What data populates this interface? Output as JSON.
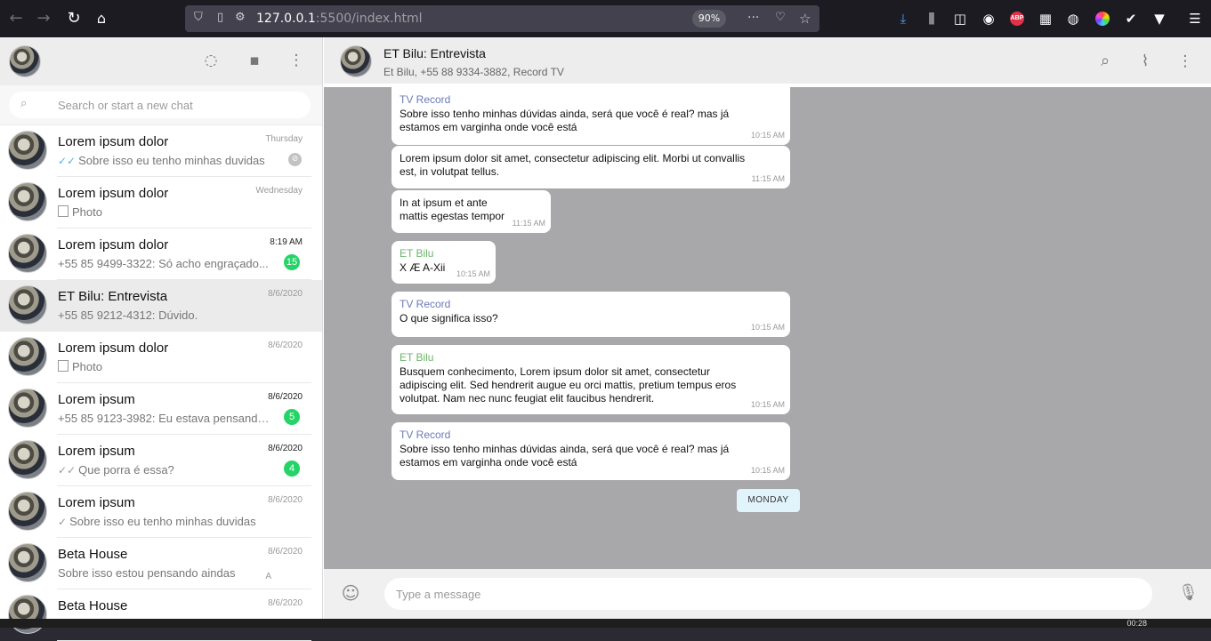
{
  "browser": {
    "url_host": "127.0.0.1",
    "url_rest": ":5500/index.html",
    "zoom": "90%",
    "abp_label": "ABP"
  },
  "sidebar": {
    "search_placeholder": "Search or start a new chat",
    "chats": [
      {
        "name": "Lorem ipsum dolor",
        "time": "Thursday",
        "time_bold": false,
        "tick": "blue",
        "preview": "Sobre isso eu tenho minhas duvidas",
        "muted": true,
        "badge": null,
        "photo": false,
        "active": false
      },
      {
        "name": "Lorem ipsum dolor",
        "time": "Wednesday",
        "time_bold": false,
        "tick": null,
        "preview": "Photo",
        "muted": false,
        "badge": null,
        "photo": true,
        "active": false
      },
      {
        "name": "Lorem ipsum dolor",
        "time": "8:19 AM",
        "time_bold": true,
        "tick": null,
        "preview": "+55 85 9499-3322: Só acho engraçado...",
        "muted": false,
        "badge": "15",
        "photo": false,
        "active": false
      },
      {
        "name": "ET Bilu: Entrevista",
        "time": "8/6/2020",
        "time_bold": false,
        "tick": null,
        "preview": "+55 85 9212-4312: Dúvido.",
        "muted": false,
        "badge": null,
        "photo": false,
        "active": true
      },
      {
        "name": "Lorem ipsum dolor",
        "time": "8/6/2020",
        "time_bold": false,
        "tick": null,
        "preview": "Photo",
        "muted": false,
        "badge": null,
        "photo": true,
        "active": false
      },
      {
        "name": "Lorem ipsum",
        "time": "8/6/2020",
        "time_bold": true,
        "tick": null,
        "preview": "+55 85 9123-3982: Eu estava pensando...",
        "muted": false,
        "badge": "5",
        "photo": false,
        "active": false
      },
      {
        "name": "Lorem ipsum",
        "time": "8/6/2020",
        "time_bold": true,
        "tick": "grey",
        "preview": "Que porra é essa?",
        "muted": false,
        "badge": "4",
        "photo": false,
        "active": false
      },
      {
        "name": "Lorem ipsum",
        "time": "8/6/2020",
        "time_bold": false,
        "tick": "grey-single",
        "preview": "Sobre isso eu tenho minhas duvidas",
        "muted": false,
        "badge": null,
        "photo": false,
        "active": false
      },
      {
        "name": "Beta House",
        "time": "8/6/2020",
        "time_bold": false,
        "tick": null,
        "preview": "Sobre isso estou pensando aindas",
        "muted": false,
        "badge": null,
        "photo": false,
        "active": false,
        "mark": "A"
      },
      {
        "name": "Beta House",
        "time": "8/6/2020",
        "time_bold": false,
        "tick": null,
        "preview": "",
        "muted": false,
        "badge": null,
        "photo": false,
        "active": false
      }
    ]
  },
  "conversation": {
    "title": "ET Bilu: Entrevista",
    "subtitle": "Et Bilu, +55 88 9334-3882, Record TV",
    "messages": [
      {
        "sender": "TV Record",
        "sender_color": "blue",
        "text": "Sobre isso tenho minhas dúvidas ainda, será que você é real? mas já estamos em varginha onde você está",
        "time": "10:15 AM"
      },
      {
        "sender": "",
        "sender_color": "blue",
        "text": "Lorem ipsum dolor sit amet, consectetur adipiscing elit. Morbi ut convallis est, in volutpat tellus.",
        "time": "11:15 AM"
      },
      {
        "sender": "",
        "sender_color": "blue",
        "text": "In at ipsum et ante mattis egestas tempor",
        "time": "11:15 AM"
      },
      {
        "sender": "ET Bilu",
        "sender_color": "green",
        "text": "X Æ A-Xii",
        "time": "10:15 AM"
      },
      {
        "sender": "TV Record",
        "sender_color": "blue",
        "text": "O que significa isso?",
        "time": "10:15 AM"
      },
      {
        "sender": "ET Bilu",
        "sender_color": "green",
        "text": "Busquem conhecimento, Lorem ipsum dolor sit amet, consectetur adipiscing elit. Sed hendrerit augue eu orci mattis, pretium tempus eros volutpat. Nam nec nunc feugiat elit faucibus hendrerit.",
        "time": "10:15 AM"
      },
      {
        "sender": "TV Record",
        "sender_color": "blue",
        "text": "Sobre isso tenho minhas dúvidas ainda, será que você é real? mas já estamos em varginha onde você está",
        "time": "10:15 AM"
      }
    ],
    "day_label": "MONDAY",
    "composer_placeholder": "Type a message"
  },
  "taskbar": {
    "clock": "00:28"
  },
  "colors": {
    "accent_green": "#25d366",
    "chat_bg": "#a8a7a9",
    "sender_blue": "#6b7bb5",
    "sender_green": "#6cb56b",
    "read_tick": "#4fb3e6"
  }
}
